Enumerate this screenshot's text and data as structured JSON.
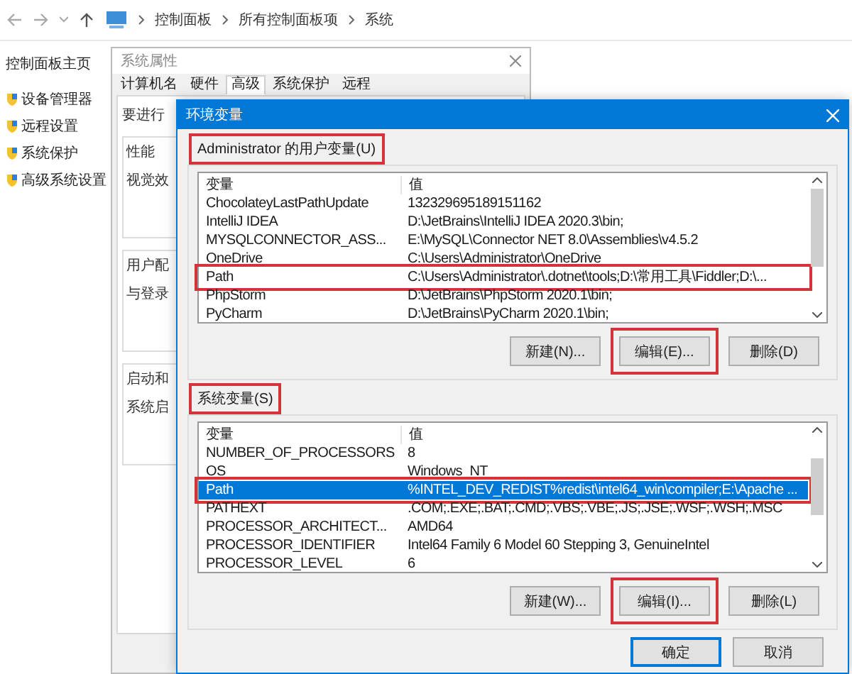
{
  "explorer": {
    "breadcrumbs": [
      "控制面板",
      "所有控制面板项",
      "系统"
    ],
    "sidebar": {
      "home_link": "控制面板主页",
      "items": [
        "设备管理器",
        "远程设置",
        "系统保护",
        "高级系统设置"
      ]
    }
  },
  "system_properties": {
    "title": "系统属性",
    "tabs": [
      {
        "label": "计算机名",
        "selected": false
      },
      {
        "label": "硬件",
        "selected": false
      },
      {
        "label": "高级",
        "selected": true
      },
      {
        "label": "系统保护",
        "selected": false
      },
      {
        "label": "远程",
        "selected": false
      }
    ],
    "intro": "要进行",
    "groups": [
      {
        "title": "性能",
        "text": "视觉效"
      },
      {
        "title": "用户配",
        "text": "与登录"
      },
      {
        "title": "启动和",
        "text": "系统启"
      }
    ]
  },
  "environment_dialog": {
    "title": "环境变量",
    "sections": [
      {
        "label": "Administrator 的用户变量(U)",
        "highlighted": true,
        "columns": [
          "变量",
          "值"
        ],
        "rows": [
          {
            "name": "ChocolateyLastPathUpdate",
            "value": "132329695189151162",
            "selected": false,
            "highlighted": false
          },
          {
            "name": "IntelliJ IDEA",
            "value": "D:\\JetBrains\\IntelliJ IDEA 2020.3\\bin;",
            "selected": false,
            "highlighted": false
          },
          {
            "name": "MYSQLCONNECTOR_ASS...",
            "value": "E:\\MySQL\\Connector NET 8.0\\Assemblies\\v4.5.2",
            "selected": false,
            "highlighted": false
          },
          {
            "name": "OneDrive",
            "value": "C:\\Users\\Administrator\\OneDrive",
            "selected": false,
            "highlighted": false
          },
          {
            "name": "Path",
            "value": "C:\\Users\\Administrator\\.dotnet\\tools;D:\\常用工具\\Fiddler;D:\\...",
            "selected": false,
            "highlighted": true
          },
          {
            "name": "PhpStorm",
            "value": "D:\\JetBrains\\PhpStorm 2020.1\\bin;",
            "selected": false,
            "highlighted": false
          },
          {
            "name": "PyCharm",
            "value": "D:\\JetBrains\\PyCharm 2020.1\\bin;",
            "selected": false,
            "highlighted": false
          }
        ],
        "buttons": [
          {
            "label": "新建(N)...",
            "highlighted": false
          },
          {
            "label": "编辑(E)...",
            "highlighted": true
          },
          {
            "label": "删除(D)",
            "highlighted": false
          }
        ]
      },
      {
        "label": "系统变量(S)",
        "highlighted": true,
        "columns": [
          "变量",
          "值"
        ],
        "rows": [
          {
            "name": "NUMBER_OF_PROCESSORS",
            "value": "8",
            "selected": false,
            "highlighted": false
          },
          {
            "name": "OS",
            "value": "Windows_NT",
            "selected": false,
            "highlighted": false
          },
          {
            "name": "Path",
            "value": "%INTEL_DEV_REDIST%redist\\intel64_win\\compiler;E:\\Apache ...",
            "selected": true,
            "highlighted": true
          },
          {
            "name": "PATHEXT",
            "value": ".COM;.EXE;.BAT;.CMD;.VBS;.VBE;.JS;.JSE;.WSF;.WSH;.MSC",
            "selected": false,
            "highlighted": false
          },
          {
            "name": "PROCESSOR_ARCHITECT...",
            "value": "AMD64",
            "selected": false,
            "highlighted": false
          },
          {
            "name": "PROCESSOR_IDENTIFIER",
            "value": "Intel64 Family 6 Model 60 Stepping 3, GenuineIntel",
            "selected": false,
            "highlighted": false
          },
          {
            "name": "PROCESSOR_LEVEL",
            "value": "6",
            "selected": false,
            "highlighted": false
          }
        ],
        "buttons": [
          {
            "label": "新建(W)...",
            "highlighted": false
          },
          {
            "label": "编辑(I)...",
            "highlighted": true
          },
          {
            "label": "删除(L)",
            "highlighted": false
          }
        ]
      }
    ],
    "buttons": [
      {
        "label": "确定",
        "default": true
      },
      {
        "label": "取消",
        "default": false
      }
    ]
  }
}
